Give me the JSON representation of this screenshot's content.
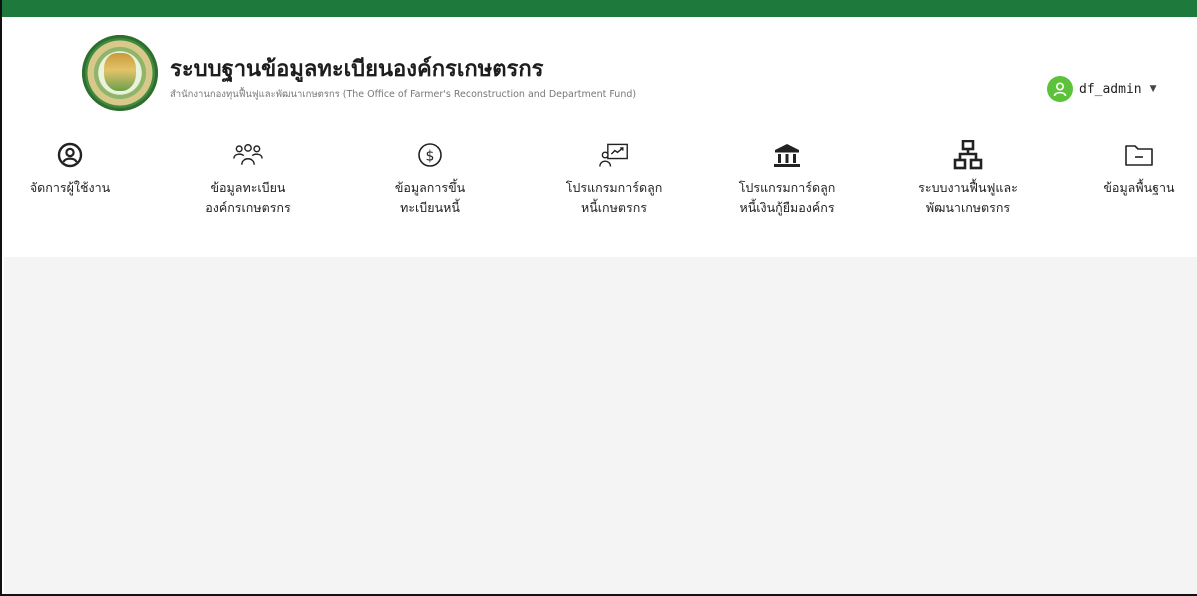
{
  "app": {
    "title": "ระบบฐานข้อมูลทะเบียนองค์กรเกษตรกร",
    "subtitle": "สำนักงานกองทุนฟื้นฟูและพัฒนาเกษตรกร (The Office of Farmer's Reconstruction and Department Fund)"
  },
  "colors": {
    "topbar": "#1e7a3c",
    "avatar": "#5cc23c",
    "content_bg": "#f4f4f4"
  },
  "user": {
    "name": "df_admin",
    "avatar_icon": "user-icon",
    "dropdown_icon": "caret-down-icon"
  },
  "menu": [
    {
      "icon": "user-circle-icon",
      "line1": "จัดการผู้ใช้งาน",
      "line2": ""
    },
    {
      "icon": "users-group-icon",
      "line1": "ข้อมูลทะเบียน",
      "line2": "องค์กรเกษตรกร"
    },
    {
      "icon": "dollar-circle-icon",
      "line1": "ข้อมูลการขึ้น",
      "line2": "ทะเบียนหนี้"
    },
    {
      "icon": "presentation-chart-icon",
      "line1": "โปรแกรมการ์ดลูก",
      "line2": "หนี้เกษตรกร"
    },
    {
      "icon": "bank-icon",
      "line1": "โปรแกรมการ์ดลูก",
      "line2": "หนี้เงินกู้ยืมองค์กร"
    },
    {
      "icon": "network-icon",
      "line1": "ระบบงานฟื้นฟูและ",
      "line2": "พัฒนาเกษตรกร"
    },
    {
      "icon": "folder-icon",
      "line1": "ข้อมูลพื้นฐาน",
      "line2": ""
    }
  ]
}
